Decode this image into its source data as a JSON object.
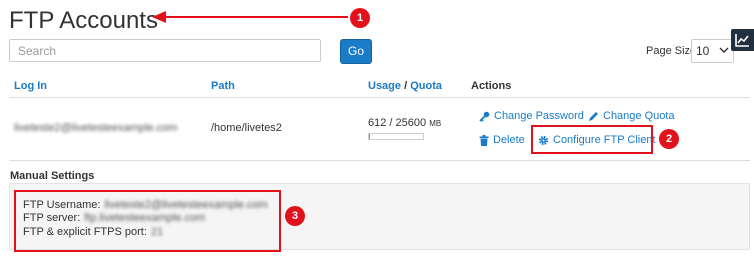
{
  "header": {
    "title": "FTP Accounts"
  },
  "annotations": {
    "badge_1": "1",
    "badge_2": "2",
    "badge_3": "3",
    "color": "#e2121c"
  },
  "search": {
    "placeholder": "Search",
    "go_label": "Go"
  },
  "page_size": {
    "label": "Page Size",
    "value": "10"
  },
  "icons": {
    "stats": "chart-line-icon",
    "password": "key-icon",
    "quota": "pencil-icon",
    "delete": "trash-icon",
    "configure": "gear-icon",
    "dropdown": "chevron-down-icon"
  },
  "table": {
    "headers": {
      "login": "Log In",
      "path": "Path",
      "usage": "Usage",
      "sep": "/",
      "quota": "Quota",
      "actions": "Actions"
    },
    "rows": [
      {
        "login": "liveteste2@livetesteexample.com",
        "path": "/home/livetes2",
        "usage": "612 / 25600",
        "usage_unit": "MB",
        "usage_fraction": 0.024,
        "actions": {
          "change_password": "Change Password",
          "change_quota": "Change Quota",
          "delete": "Delete",
          "configure": "Configure FTP Client"
        }
      }
    ]
  },
  "manual_settings": {
    "title": "Manual Settings",
    "username_label": "FTP Username:",
    "username_value": "liveteste2@livetesteexample.com",
    "server_label": "FTP server:",
    "server_value": "ftp.livetesteexample.com",
    "port_label": "FTP & explicit FTPS port:",
    "port_value": "21"
  },
  "colors": {
    "link": "#1a7bc6",
    "go_button": "#1a7bc6",
    "quota_fill": "#5cb85c",
    "panel": "#f5f5f5"
  }
}
